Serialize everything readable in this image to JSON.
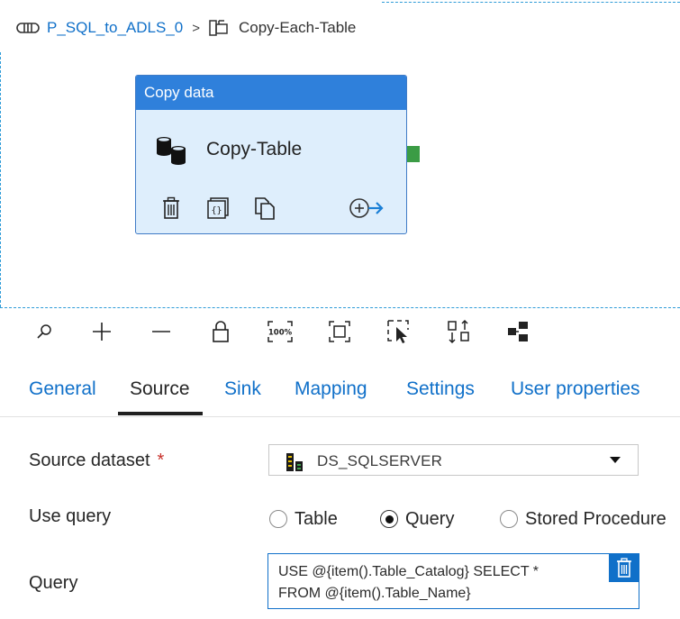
{
  "breadcrumb": {
    "pipeline_name": "P_SQL_to_ADLS_0",
    "separator": ">",
    "activity_name": "Copy-Each-Table",
    "pipeline_icon": "pipeline-icon",
    "foreach_icon": "foreach-icon"
  },
  "activity_card": {
    "type_label": "Copy data",
    "name": "Copy-Table",
    "icon": "database-copy-icon",
    "actions": [
      "delete-icon",
      "code-icon",
      "clone-icon",
      "add-output-icon"
    ],
    "header_color": "#2f80db",
    "body_color": "#deeefc",
    "success_handle_color": "#3b9c45"
  },
  "toolbar": {
    "tools": [
      "search-icon",
      "zoom-in-icon",
      "zoom-out-icon",
      "lock-icon",
      "zoom-100-icon",
      "fit-to-screen-icon",
      "select-icon",
      "auto-align-icon",
      "layout-icon"
    ],
    "zoom_100_label": "100%"
  },
  "tabs": {
    "items": [
      {
        "label": "General"
      },
      {
        "label": "Source"
      },
      {
        "label": "Sink"
      },
      {
        "label": "Mapping"
      },
      {
        "label": "Settings"
      },
      {
        "label": "User properties"
      }
    ],
    "active": "Source"
  },
  "source": {
    "dataset_label": "Source dataset",
    "required_mark": "*",
    "dataset_value": "DS_SQLSERVER",
    "dataset_icon": "sql-server-icon",
    "use_query_label": "Use query",
    "use_query_options": [
      "Table",
      "Query",
      "Stored Procedure"
    ],
    "use_query_selected": "Query",
    "query_label": "Query",
    "query_lines": [
      "USE @{item().Table_Catalog} SELECT *",
      "FROM @{item().Table_Name}"
    ]
  },
  "colors": {
    "link": "#1070c9",
    "accent": "#1070c9",
    "required": "#c8312b"
  }
}
